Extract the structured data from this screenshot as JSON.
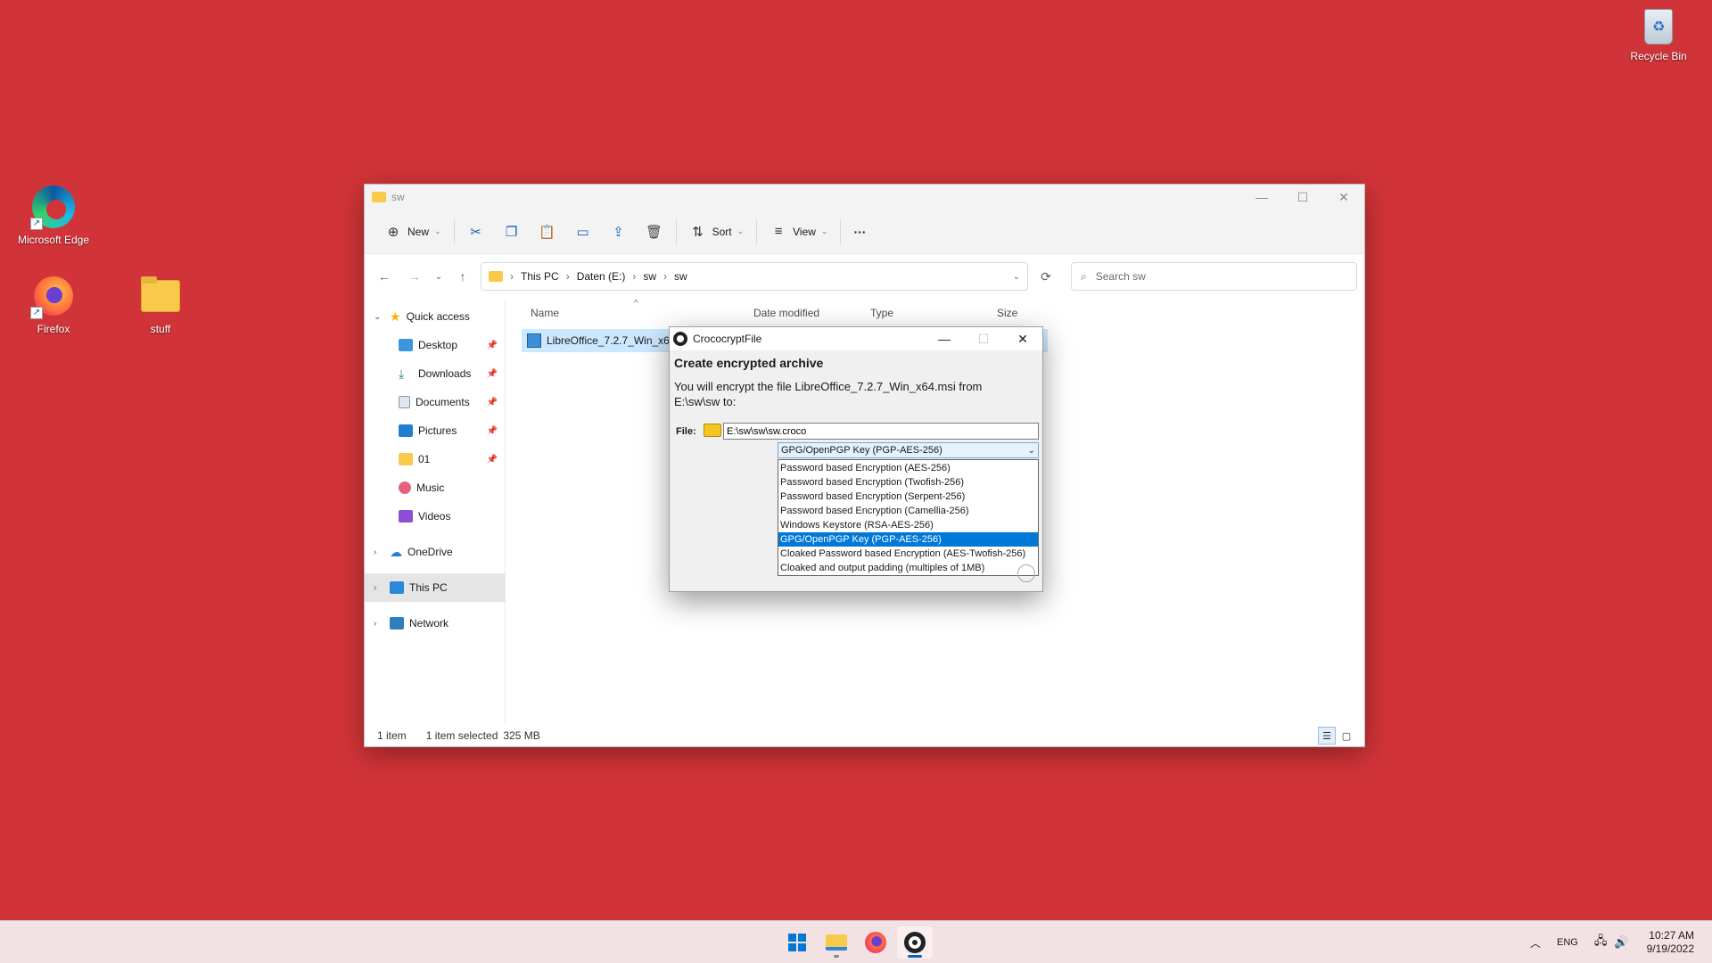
{
  "desktop": {
    "icons": [
      {
        "label": "Microsoft Edge"
      },
      {
        "label": "Firefox"
      },
      {
        "label": "stuff"
      }
    ],
    "recycle_bin": "Recycle Bin"
  },
  "explorer": {
    "title": "sw",
    "toolbar": {
      "new_label": "New",
      "sort_label": "Sort",
      "view_label": "View",
      "more_label": "···"
    },
    "breadcrumb": [
      "This PC",
      "Daten (E:)",
      "sw",
      "sw"
    ],
    "search_placeholder": "Search sw",
    "nav": {
      "quick_access": "Quick access",
      "items": [
        "Desktop",
        "Downloads",
        "Documents",
        "Pictures",
        "01",
        "Music",
        "Videos"
      ],
      "onedrive": "OneDrive",
      "this_pc": "This PC",
      "network": "Network"
    },
    "columns": {
      "name": "Name",
      "date": "Date modified",
      "type": "Type",
      "size": "Size"
    },
    "files": [
      {
        "name": "LibreOffice_7.2.7_Win_x64"
      }
    ],
    "status": {
      "count": "1 item",
      "selected": "1 item selected",
      "size": "325 MB"
    }
  },
  "dialog": {
    "title": "CrococryptFile",
    "heading": "Create encrypted archive",
    "description": "You will encrypt the file LibreOffice_7.2.7_Win_x64.msi from E:\\sw\\sw to:",
    "file_label": "File:",
    "file_value": "E:\\sw\\sw\\sw.croco",
    "selected_method": "GPG/OpenPGP Key (PGP-AES-256)",
    "options": [
      "Password based Encryption (AES-256)",
      "Password based Encryption (Twofish-256)",
      "Password based Encryption (Serpent-256)",
      "Password based Encryption (Camellia-256)",
      "Windows Keystore (RSA-AES-256)",
      "GPG/OpenPGP Key (PGP-AES-256)",
      "Cloaked Password based Encryption (AES-Twofish-256)",
      "Cloaked and output padding (multiples of 1MB)"
    ],
    "selected_index": 5
  },
  "taskbar": {
    "lang": "ENG",
    "time": "10:27 AM",
    "date": "9/19/2022"
  },
  "colors": {
    "desktop_bg": "#d13438",
    "accent": "#0078d7",
    "selection": "#cce8ff"
  }
}
